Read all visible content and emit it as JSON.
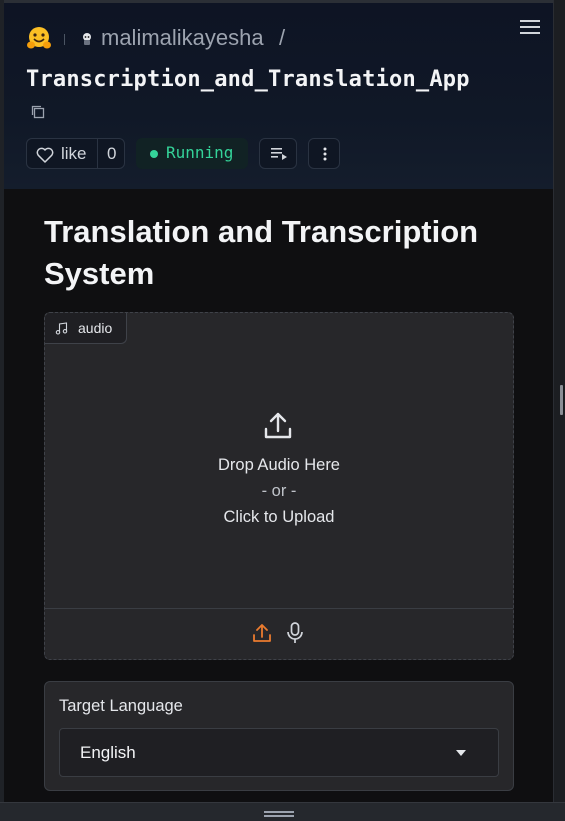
{
  "header": {
    "owner": "malimalikayesha",
    "slash": "/",
    "repo": "Transcription_and_Translation_App",
    "like_label": "like",
    "like_count": "0",
    "status": "Running",
    "status_color": "#34d399"
  },
  "app": {
    "title": "Translation and Transcription System",
    "audio": {
      "tag": "audio",
      "drop_text": "Drop Audio Here",
      "or_text": "- or -",
      "click_text": "Click to Upload"
    },
    "language": {
      "label": "Target Language",
      "value": "English"
    }
  },
  "colors": {
    "upload_accent": "#ea7b2f",
    "background": "#0f0f11"
  }
}
